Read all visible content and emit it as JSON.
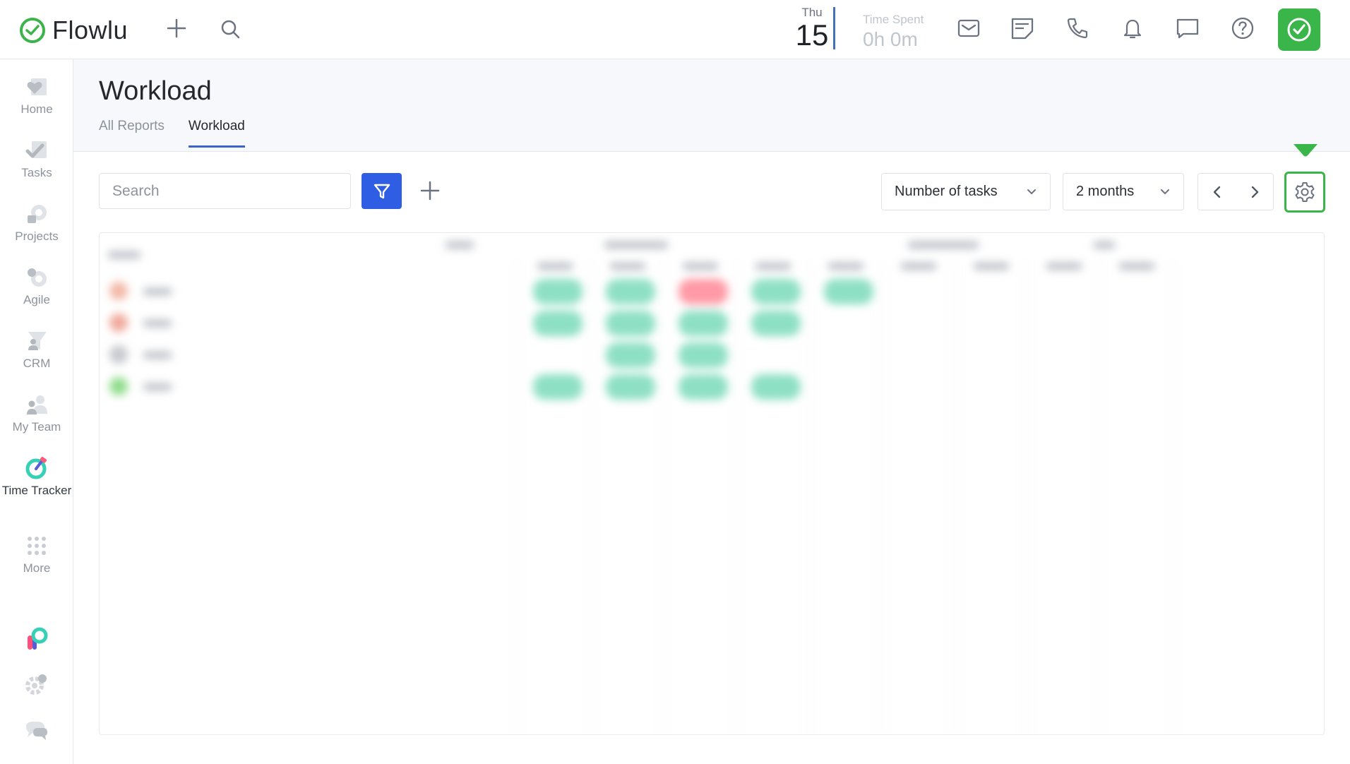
{
  "app": {
    "name": "Flowlu",
    "date": {
      "day_of_week": "Thu",
      "day": "15"
    },
    "time_spent": {
      "label": "Time Spent",
      "value": "0h 0m"
    }
  },
  "icons": {
    "logo": "check-circle-icon",
    "add": "plus-icon",
    "search": "search-icon",
    "mail": "envelope-icon",
    "notes": "note-icon",
    "phone": "phone-icon",
    "bell": "bell-icon",
    "chat": "chat-icon",
    "help": "help-circle-icon",
    "timer": "check-shield-icon"
  },
  "colors": {
    "brand_green": "#3ab54a",
    "primary_blue": "#2f5de3",
    "tab_underline": "#3b63c9",
    "bar_green": "#8ee0c4",
    "bar_red": "#ff9aa6"
  },
  "sidebar": {
    "items": [
      {
        "label": "Home",
        "icon": "home-icon"
      },
      {
        "label": "Tasks",
        "icon": "tasks-icon"
      },
      {
        "label": "Projects",
        "icon": "projects-icon"
      },
      {
        "label": "Agile",
        "icon": "agile-icon"
      },
      {
        "label": "CRM",
        "icon": "crm-icon"
      },
      {
        "label": "My Team",
        "icon": "team-icon"
      },
      {
        "label": "Time Tracker",
        "icon": "timer-icon"
      },
      {
        "label": "More",
        "icon": "grid-dots-icon"
      }
    ],
    "bottom_icons": [
      "flowlu-apps-icon",
      "settings-icon",
      "support-chat-icon"
    ]
  },
  "page": {
    "title": "Workload",
    "tabs": [
      {
        "label": "All Reports",
        "active": false
      },
      {
        "label": "Workload",
        "active": true
      }
    ]
  },
  "toolbar": {
    "search_placeholder": "Search",
    "metric_selected": "Number of tasks",
    "period_selected": "2 months"
  },
  "grid": {
    "rows": [
      {
        "avatar_color": "#f2b8a6",
        "cells": [
          "g",
          "g",
          "r",
          "g",
          "g",
          "",
          "",
          "",
          ""
        ]
      },
      {
        "avatar_color": "#f0a899",
        "cells": [
          "g",
          "g",
          "g",
          "g",
          "",
          "",
          "",
          "",
          ""
        ]
      },
      {
        "avatar_color": "#c5c8cd",
        "cells": [
          "",
          "g",
          "g",
          "",
          "",
          "",
          "",
          "",
          ""
        ]
      },
      {
        "avatar_color": "#8fdc8a",
        "cells": [
          "g",
          "g",
          "g",
          "g",
          "",
          "",
          "",
          "",
          ""
        ]
      }
    ]
  }
}
